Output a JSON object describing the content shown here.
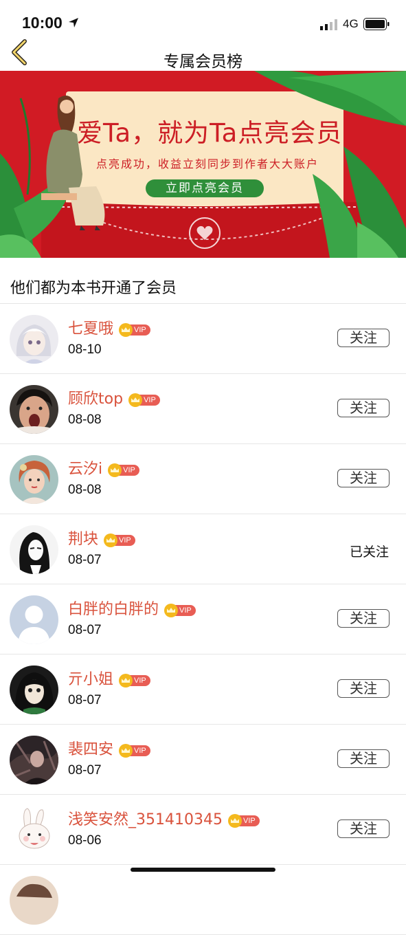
{
  "status_bar": {
    "time": "10:00",
    "network": "4G"
  },
  "nav": {
    "title": "专属会员榜"
  },
  "banner": {
    "headline": "爱Ta，就为Ta点亮会员",
    "subtitle": "点亮成功，收益立刻同步到作者大大账户",
    "cta": "立即点亮会员"
  },
  "section": {
    "title": "他们都为本书开通了会员"
  },
  "vip_label": "VIP",
  "members": [
    {
      "name": "七夏哦",
      "date": "08-10",
      "follow": "关注",
      "followed": false,
      "avatar": "anime-girl-white-hair"
    },
    {
      "name": "顾欣top",
      "date": "08-08",
      "follow": "关注",
      "followed": false,
      "avatar": "photo-shouting"
    },
    {
      "name": "云汐i",
      "date": "08-08",
      "follow": "关注",
      "followed": false,
      "avatar": "illustrated-girl"
    },
    {
      "name": "荆块",
      "date": "08-07",
      "follow": "已关注",
      "followed": true,
      "avatar": "anime-dark-hair"
    },
    {
      "name": "白胖的白胖的",
      "date": "08-07",
      "follow": "关注",
      "followed": false,
      "avatar": "default-avatar"
    },
    {
      "name": "亓小姐",
      "date": "08-07",
      "follow": "关注",
      "followed": false,
      "avatar": "anime-green"
    },
    {
      "name": "裴四安",
      "date": "08-07",
      "follow": "关注",
      "followed": false,
      "avatar": "dark-art"
    },
    {
      "name": "浅笑安然_351410345",
      "date": "08-06",
      "follow": "关注",
      "followed": false,
      "avatar": "bunny-sticker"
    }
  ],
  "colors": {
    "name": "#d9523c",
    "banner_red": "#d11b24",
    "cta_green": "#2f8f3a",
    "vip_tag": "#e85d54"
  }
}
